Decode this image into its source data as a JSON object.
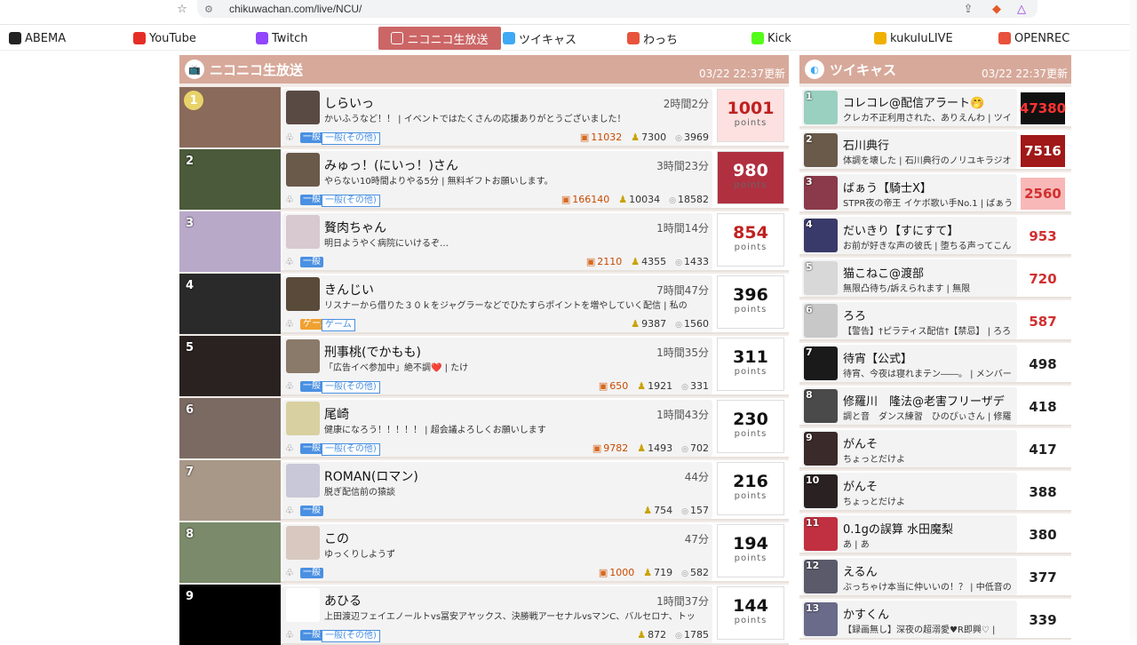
{
  "browser": {
    "url": "chikuwachan.com/live/NCU/"
  },
  "nav": [
    {
      "label": "ABEMA",
      "color": "#222222"
    },
    {
      "label": "YouTube",
      "color": "#e52d27"
    },
    {
      "label": "Twitch",
      "color": "#9146ff"
    },
    {
      "label": "ニコニコ生放送",
      "color": "#ffffff"
    },
    {
      "label": "ツイキャス",
      "color": "#3fa9f5"
    },
    {
      "label": "わっち",
      "color": "#e8533c"
    },
    {
      "label": "Kick",
      "color": "#53fc18"
    },
    {
      "label": "kukuluLIVE",
      "color": "#f0b000"
    },
    {
      "label": "OPENREC",
      "color": "#e8513c"
    }
  ],
  "nico": {
    "title": "ニコニコ生放送",
    "updated": "03/22 22:37更新",
    "rows": [
      {
        "rank": "1",
        "name": "しらいっ",
        "duration": "2時間2分",
        "desc": "かいふうなど！！ | イベントではたくさんの応援ありがとうございました！",
        "badge": "一般",
        "category": "一般(その他)",
        "gift": "11032",
        "viewers": "7300",
        "comments": "3969",
        "points": "1001",
        "thumb": "#8a6a5a",
        "avatar": "#5a4a44"
      },
      {
        "rank": "2",
        "name": "みゅっ！(にいっ！)さん",
        "duration": "3時間23分",
        "desc": "やらない10時間よりやる5分 | 無料ギフトお願いします。",
        "badge": "一般",
        "category": "一般(その他)",
        "gift": "166140",
        "viewers": "10034",
        "comments": "18582",
        "points": "980",
        "thumb": "#4a5a3a",
        "avatar": "#6a5a4a"
      },
      {
        "rank": "3",
        "name": "贅肉ちゃん",
        "duration": "1時間14分",
        "desc": "明日ようやく病院にいけるぞ…",
        "badge": "一般",
        "category": "",
        "gift": "2110",
        "viewers": "4355",
        "comments": "1433",
        "points": "854",
        "thumb": "#b9a9c9",
        "avatar": "#d8c8d0"
      },
      {
        "rank": "4",
        "name": "きんじい",
        "duration": "7時間47分",
        "desc": "リスナーから借りた３０ｋをジャグラーなどでひたすらポイントを増やしていく配信 | 私の",
        "badge": "ゲーム",
        "category": "ゲーム",
        "gift": "",
        "viewers": "9387",
        "comments": "1560",
        "points": "396",
        "thumb": "#2a2a2a",
        "avatar": "#5a4a3a"
      },
      {
        "rank": "5",
        "name": "刑事桃(でかもも)",
        "duration": "1時間35分",
        "desc": "「広告イベ参加中」絶不調❤️ | たけ",
        "badge": "一般",
        "category": "一般(その他)",
        "gift": "650",
        "viewers": "1921",
        "comments": "331",
        "points": "311",
        "thumb": "#2a2220",
        "avatar": "#8a7a6a"
      },
      {
        "rank": "6",
        "name": "尾崎",
        "duration": "1時間43分",
        "desc": "健康になろう！！！！！ | 超会議よろしくお願いします",
        "badge": "一般",
        "category": "一般(その他)",
        "gift": "9782",
        "viewers": "1493",
        "comments": "702",
        "points": "230",
        "thumb": "#7a6a62",
        "avatar": "#d8d0a0"
      },
      {
        "rank": "7",
        "name": "ROMAN(ロマン)",
        "duration": "44分",
        "desc": "脱ぎ配信前の猿談",
        "badge": "一般",
        "category": "",
        "gift": "",
        "viewers": "754",
        "comments": "157",
        "points": "216",
        "thumb": "#a89888",
        "avatar": "#c8c8d8"
      },
      {
        "rank": "8",
        "name": "この",
        "duration": "47分",
        "desc": "ゆっくりしようず",
        "badge": "一般",
        "category": "",
        "gift": "1000",
        "viewers": "719",
        "comments": "582",
        "points": "194",
        "thumb": "#7a8a6a",
        "avatar": "#d8c8c0"
      },
      {
        "rank": "9",
        "name": "あひる",
        "duration": "1時間37分",
        "desc": "上田渡辺フェイエノールトvs冨安アヤックス、決勝戦アーセナルvsマンC、バルセロナ、トッ",
        "badge": "一般",
        "category": "一般(その他)",
        "gift": "",
        "viewers": "872",
        "comments": "1785",
        "points": "144",
        "thumb": "#000000",
        "avatar": "#ffffff"
      }
    ]
  },
  "twitcas": {
    "title": "ツイキャス",
    "updated": "03/22 22:37更新",
    "rows": [
      {
        "rank": "1",
        "name": "コレコレ@配信アラート🤭",
        "desc": "クレカ不正利用された、ありえんわ | ツイ",
        "points": "47380",
        "bg": "#111111",
        "fg": "#ff3333",
        "avatar": "#9ad0c0"
      },
      {
        "rank": "2",
        "name": "石川典行",
        "desc": "体調を壊した | 石川典行のノリユキラジオ",
        "points": "7516",
        "bg": "#a01818",
        "fg": "#ffffff",
        "avatar": "#6a5a4a"
      },
      {
        "rank": "3",
        "name": "ばぁう【騎士X】",
        "desc": "STPR夜の帝王 イケボ歌い手No.1 | ばぁう",
        "points": "2560",
        "bg": "#f8b8b8",
        "fg": "#d03030",
        "avatar": "#8a3a4a"
      },
      {
        "rank": "4",
        "name": "だいきり【すにすて】",
        "desc": "お前が好きな声の彼氏 | 堕ちる声ってこん",
        "points": "953",
        "bg": "#ffffff",
        "fg": "#d03030",
        "avatar": "#3a3a6a"
      },
      {
        "rank": "5",
        "name": "猫こねこ@渡部",
        "desc": "無限凸待ち/訴えられます | 無限",
        "points": "720",
        "bg": "#ffffff",
        "fg": "#d03030",
        "avatar": "#d8d8d8"
      },
      {
        "rank": "6",
        "name": "ろろ",
        "desc": "【警告】†ピラティス配信†【禁忌】 | ろろ",
        "points": "587",
        "bg": "#ffffff",
        "fg": "#d03030",
        "avatar": "#c8c8c8"
      },
      {
        "rank": "7",
        "name": "待宵【公式】",
        "desc": "待宵、今夜は寝れまテン――。 | メンバー",
        "points": "498",
        "bg": "#ffffff",
        "fg": "#222222",
        "avatar": "#1a1a1a"
      },
      {
        "rank": "8",
        "name": "修羅川　隆法@老害フリーザデ",
        "desc": "調と音　ダンス練習　ひのぴぃさん | 修羅",
        "points": "418",
        "bg": "#ffffff",
        "fg": "#222222",
        "avatar": "#4a4a4a"
      },
      {
        "rank": "9",
        "name": "がんそ",
        "desc": "ちょっとだけよ",
        "points": "417",
        "bg": "#ffffff",
        "fg": "#222222",
        "avatar": "#3a2a2a"
      },
      {
        "rank": "10",
        "name": "がんそ",
        "desc": "ちょっとだけよ",
        "points": "388",
        "bg": "#ffffff",
        "fg": "#222222",
        "avatar": "#2a2222"
      },
      {
        "rank": "11",
        "name": "0.1gの誤算 水田魔梨",
        "desc": "あ | あ",
        "points": "380",
        "bg": "#ffffff",
        "fg": "#222222",
        "avatar": "#c03040"
      },
      {
        "rank": "12",
        "name": "えるん",
        "desc": "ぶっちゃけ本当に仲いいの！？ | 中低音の",
        "points": "377",
        "bg": "#ffffff",
        "fg": "#222222",
        "avatar": "#5a5a6a"
      },
      {
        "rank": "13",
        "name": "かすくん",
        "desc": "【録画無し】深夜の超溺愛♥R即興♡ | ",
        "points": "339",
        "bg": "#ffffff",
        "fg": "#222222",
        "avatar": "#6a6a8a"
      }
    ]
  },
  "labels": {
    "points_unit": "points"
  }
}
